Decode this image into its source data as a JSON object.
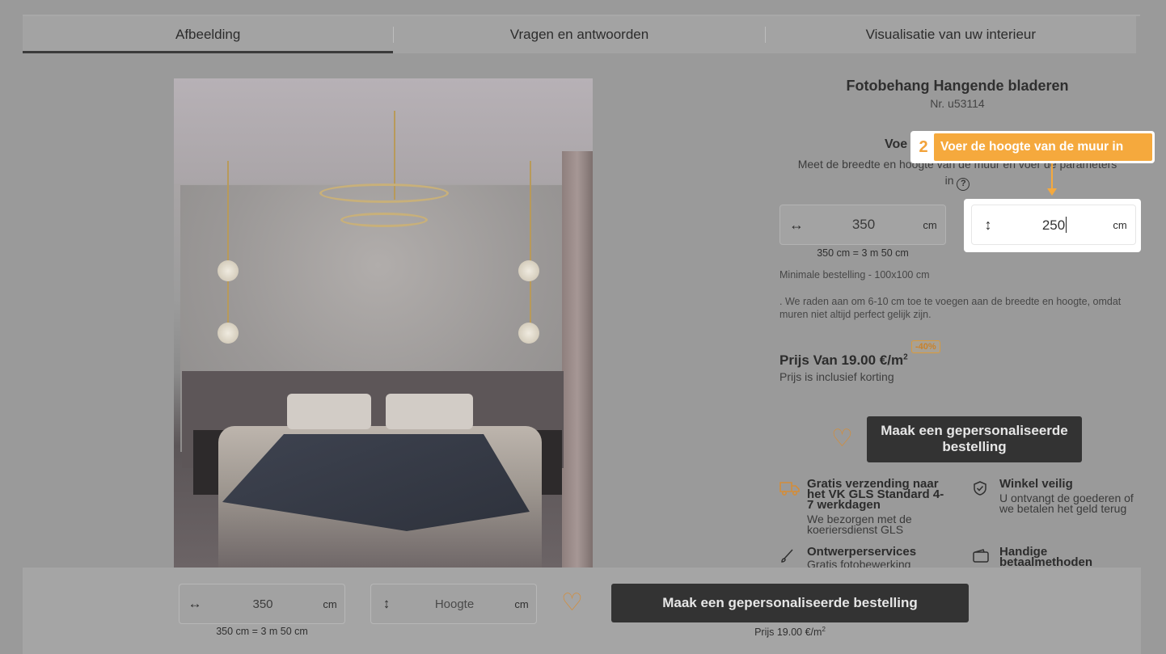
{
  "tabs": [
    {
      "label": "Afbeelding"
    },
    {
      "label": "Vragen en antwoorden"
    },
    {
      "label": "Visualisatie van uw interieur"
    }
  ],
  "product": {
    "title": "Fotobehang Hangende bladeren",
    "number": "Nr. u53114"
  },
  "dimensions": {
    "heading": "Voe",
    "description": "Meet de breedte en hoogte van de muur en voer de parameters in",
    "help_icon": "?",
    "width_icon": "↔",
    "height_icon": "↕",
    "width_value": "350",
    "height_value": "250",
    "unit": "cm",
    "width_conversion": "350 cm = 3 m 50 cm",
    "min_order": "Minimale bestelling - 100x100 cm",
    "advice": ". We raden aan om 6-10 cm toe te voegen aan de breedte en hoogte, omdat muren niet altijd perfect gelijk zijn."
  },
  "tooltip": {
    "step": "2",
    "text": "Voer de hoogte van de muur in"
  },
  "pricing": {
    "price": "Prijs Van 19.00 €/m",
    "price_sup": "2",
    "discount": "-40%",
    "note": "Prijs is inclusief korting"
  },
  "actions": {
    "favorite_icon": "♡",
    "order_button": "Maak een gepersonaliseerde bestelling"
  },
  "features": [
    {
      "icon": "truck-icon",
      "title": "Gratis verzending naar het VK GLS Standard 4-7 werkdagen",
      "desc": "We bezorgen met de koeriersdienst GLS"
    },
    {
      "icon": "shield-check-icon",
      "title": "Winkel veilig",
      "desc": "U ontvangt de goederen of we betalen het geld terug"
    },
    {
      "icon": "brush-icon",
      "title": "Ontwerperservices",
      "desc": "Gratis fotobewerking"
    },
    {
      "icon": "wallet-icon",
      "title": "Handige betaalmethoden",
      "desc": ""
    }
  ],
  "bottom_bar": {
    "width_value": "350",
    "height_placeholder": "Hoogte",
    "unit": "cm",
    "width_conversion": "350 cm = 3 m 50 cm",
    "order_button": "Maak een gepersonaliseerde bestelling",
    "price": "Prijs 19.00 €/m",
    "price_sup": "2"
  },
  "colors": {
    "accent": "#f5a93d",
    "button": "#333333",
    "overlay": "#9a9a9a"
  }
}
